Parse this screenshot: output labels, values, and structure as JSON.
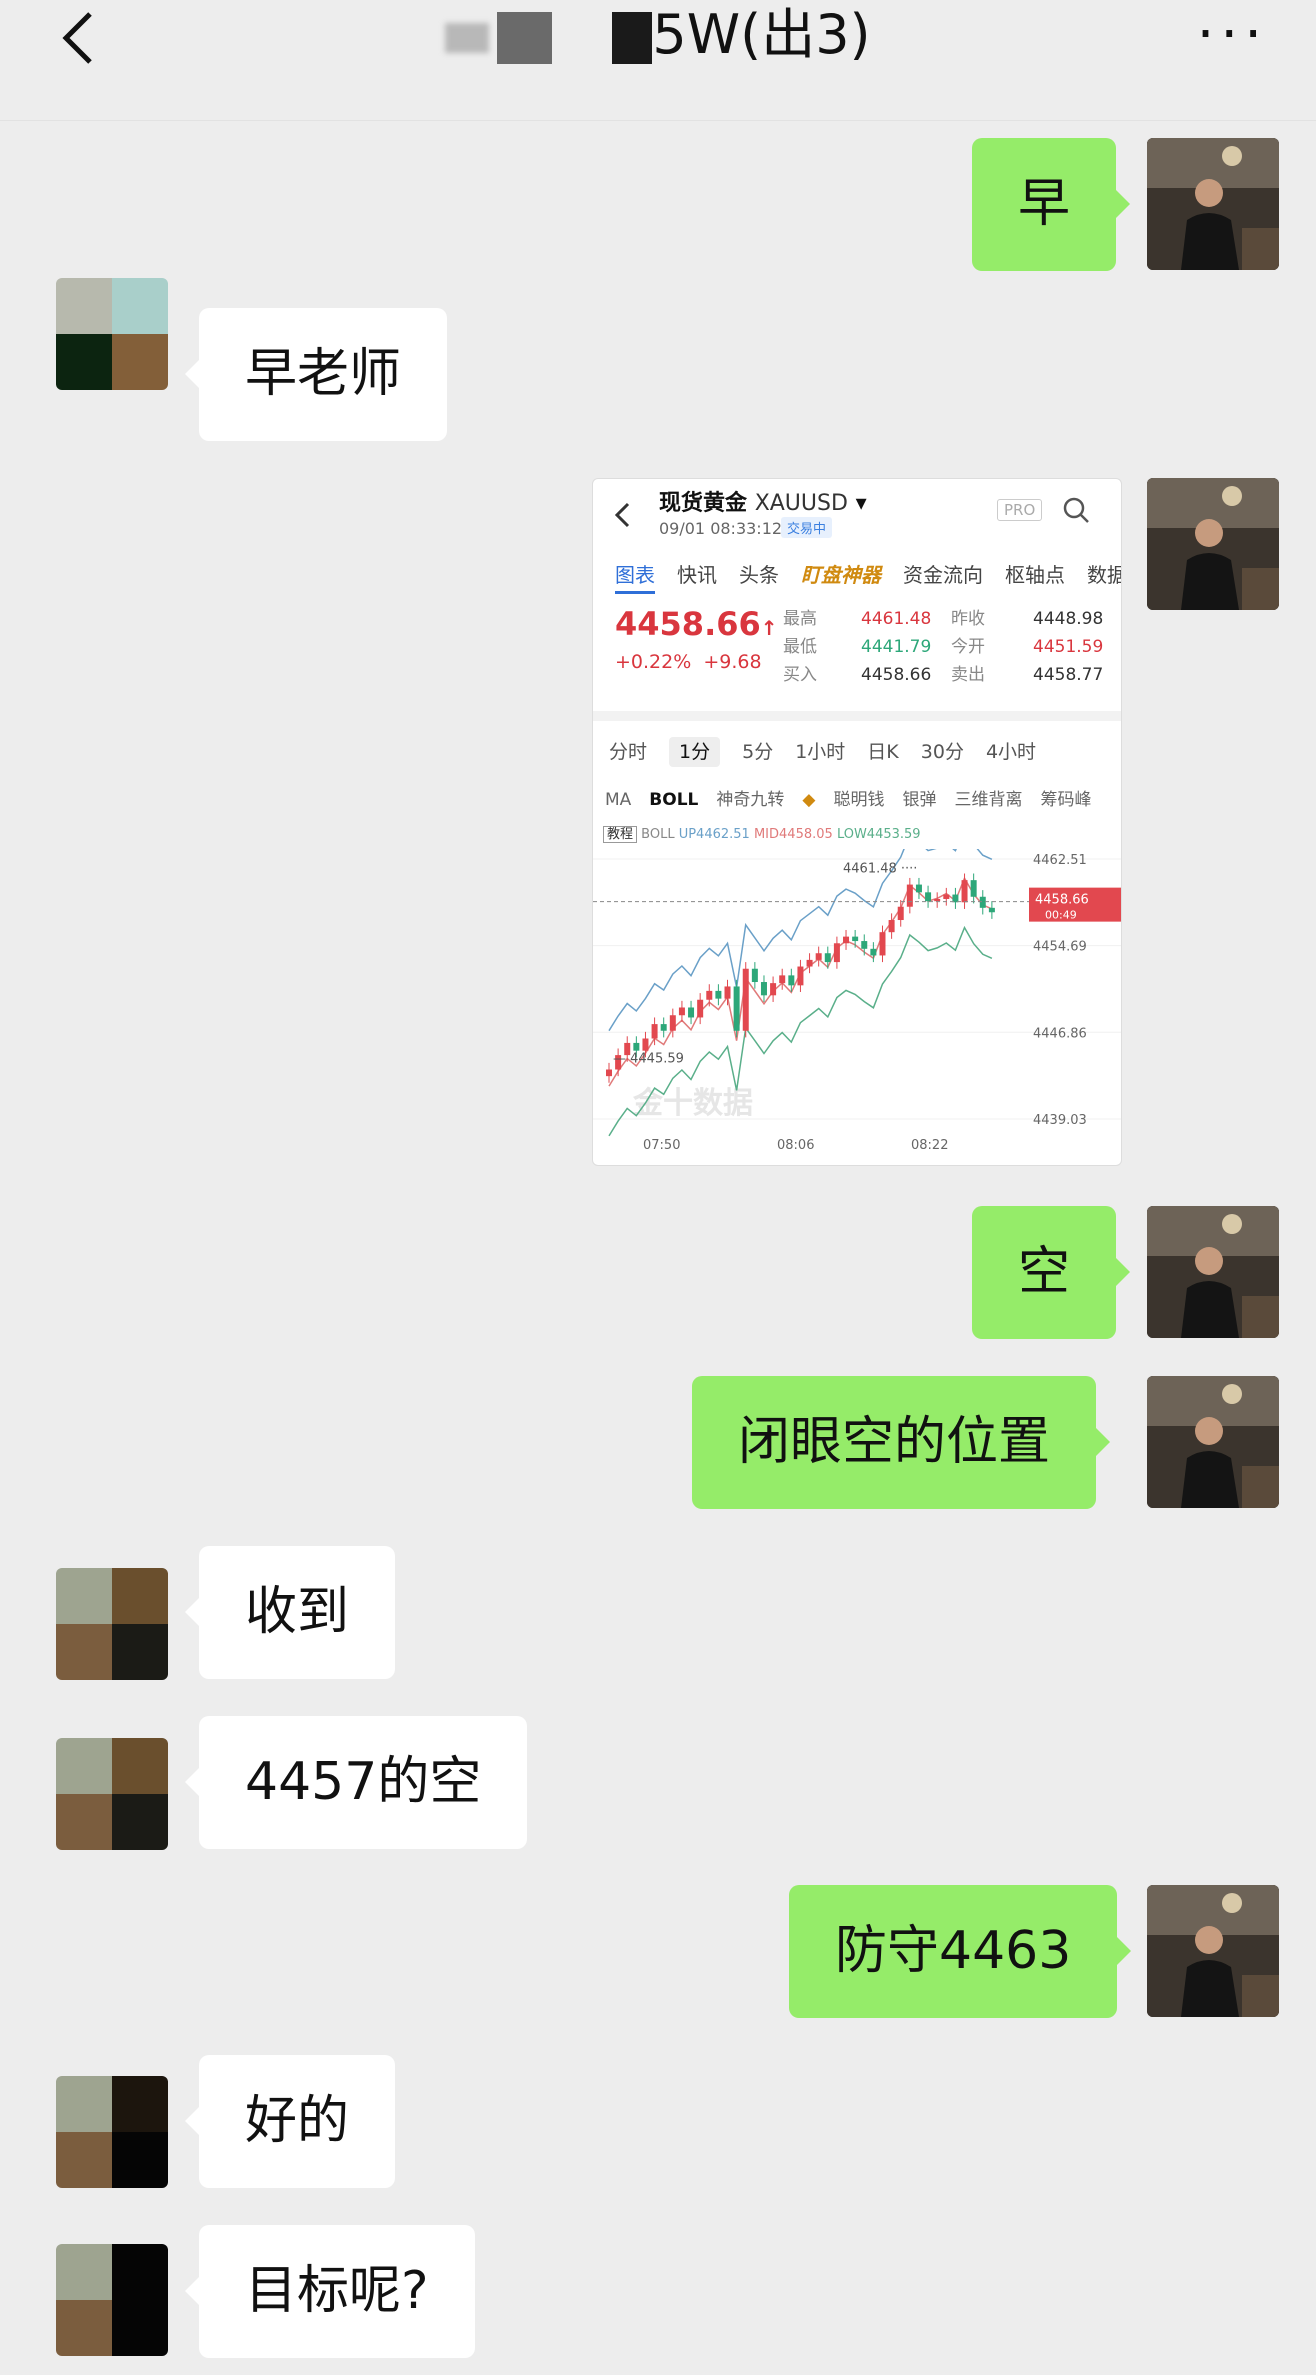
{
  "header": {
    "title_suffix": "5W(出3)",
    "more": "···"
  },
  "messages": {
    "m1": "早",
    "m2": "早老师",
    "m4": "空",
    "m5": "闭眼空的位置",
    "m6": "收到",
    "m7": "4457的空",
    "m8": "防守4463",
    "m9": "好的",
    "m10": "目标呢?"
  },
  "quote": {
    "name": "现货黄金",
    "symbol": "XAUUSD",
    "time": "09/01 08:33:12",
    "status": "交易中",
    "pro": "PRO",
    "tabs": [
      "图表",
      "快讯",
      "头条",
      "盯盘神器",
      "资金流向",
      "枢轴点",
      "数据"
    ],
    "price": "4458.66",
    "change": "+0.22%",
    "change_abs": "+9.68",
    "labels": {
      "high": "最高",
      "low": "最低",
      "buy": "买入",
      "prev": "昨收",
      "open": "今开",
      "sell": "卖出"
    },
    "high": "4461.48",
    "low": "4441.79",
    "buy": "4458.66",
    "prev": "4448.98",
    "open": "4451.59",
    "sell": "4458.77",
    "periods": [
      "分时",
      "1分",
      "5分",
      "1小时",
      "日K",
      "30分",
      "4小时"
    ],
    "indicators": [
      "MA",
      "BOLL",
      "神奇九转",
      "聪明钱",
      "银弹",
      "三维背离",
      "筹码峰"
    ],
    "boll_tag": "教程",
    "boll_up": "UP4462.51",
    "boll_mid": "MID4458.05",
    "boll_low": "LOW4453.59",
    "watermark": "金十数据"
  },
  "chart_data": {
    "type": "candlestick",
    "x_ticks": [
      "07:50",
      "08:06",
      "08:22"
    ],
    "y_ticks": [
      4462.51,
      4454.69,
      4446.86,
      4439.03
    ],
    "ylim": [
      4439.03,
      4462.51
    ],
    "current_price": 4458.66,
    "current_tag": "00:49",
    "max_label": 4461.48,
    "min_label": 4445.59,
    "closes": [
      4443.5,
      4444.8,
      4445.9,
      4445.2,
      4446.3,
      4447.6,
      4447.0,
      4448.4,
      4449.1,
      4448.2,
      4449.8,
      4450.6,
      4449.9,
      4451.0,
      4447.0,
      4452.6,
      4451.4,
      4450.2,
      4451.3,
      4452.0,
      4451.1,
      4452.8,
      4453.4,
      4454.0,
      4453.2,
      4454.9,
      4455.5,
      4455.1,
      4454.4,
      4453.8,
      4455.9,
      4457.0,
      4458.2,
      4460.2,
      4459.5,
      4458.7,
      4458.9,
      4459.3,
      4458.6,
      4460.6,
      4459.1,
      4458.1,
      4457.7
    ],
    "boll_upper_end": 4462.51,
    "boll_mid_end": 4458.05,
    "boll_lower_end": 4453.59,
    "colors": {
      "up": "#e2484f",
      "down": "#2da779",
      "upper": "#6aa0c8",
      "mid": "#e07a7a",
      "lower": "#5aaf8a"
    }
  }
}
